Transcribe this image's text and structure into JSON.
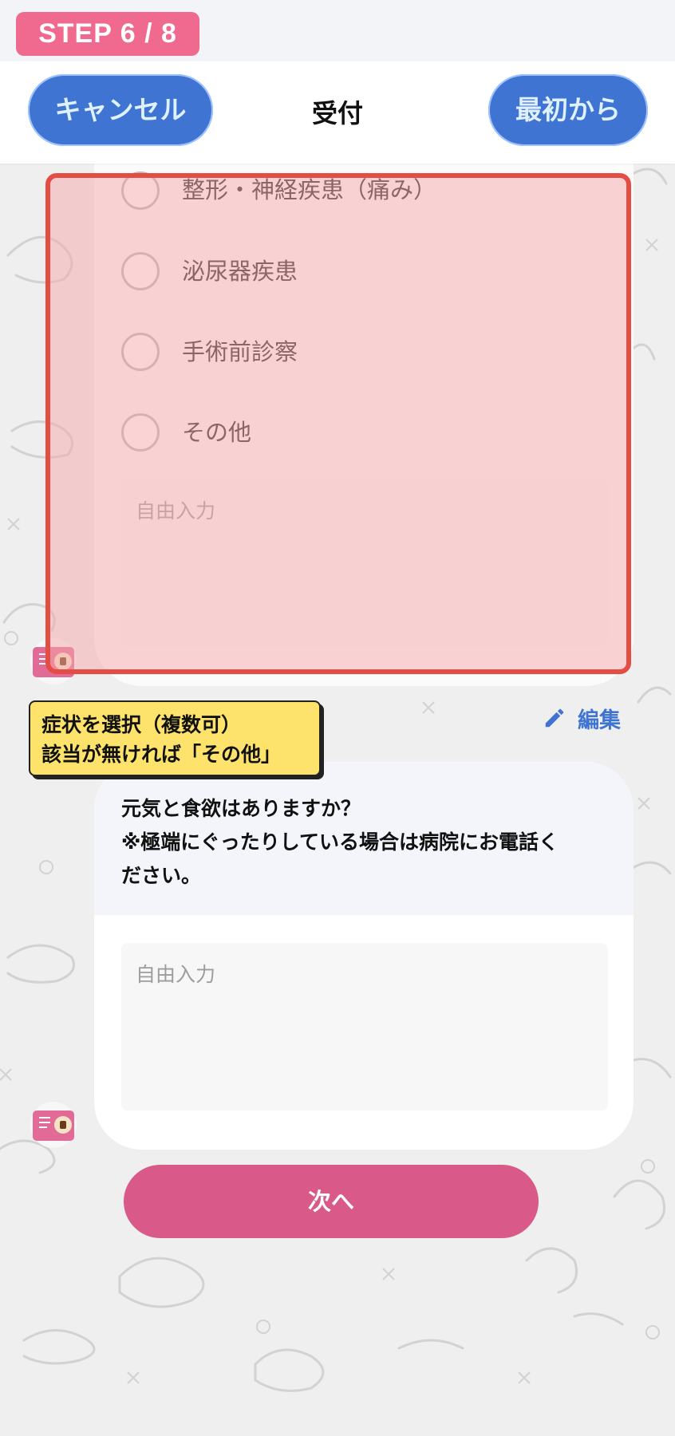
{
  "step_badge": "STEP 6 / 8",
  "header": {
    "cancel_label": "キャンセル",
    "title": "受付",
    "restart_label": "最初から"
  },
  "symptom_options": [
    {
      "label": "整形・神経疾患（痛み）"
    },
    {
      "label": "泌尿器疾患"
    },
    {
      "label": "手術前診察"
    },
    {
      "label": "その他"
    }
  ],
  "free_input_1": {
    "placeholder": "自由入力",
    "value": ""
  },
  "edit_label": "編集",
  "callout": {
    "line1": "症状を選択（複数可）",
    "line2": "該当が無ければ「その他」"
  },
  "question": {
    "line1": "元気と食欲はありますか？",
    "line2": "※極端にぐったりしている場合は病院にお電話く",
    "line3": "ださい。"
  },
  "free_input_2": {
    "placeholder": "自由入力",
    "value": ""
  },
  "next_label": "次へ",
  "colors": {
    "accent_blue": "#3f74d2",
    "step_pink": "#ef6a8e",
    "next_pink": "#d95a88",
    "highlight_red": "#e44d43",
    "callout_yellow": "#fde36b"
  }
}
